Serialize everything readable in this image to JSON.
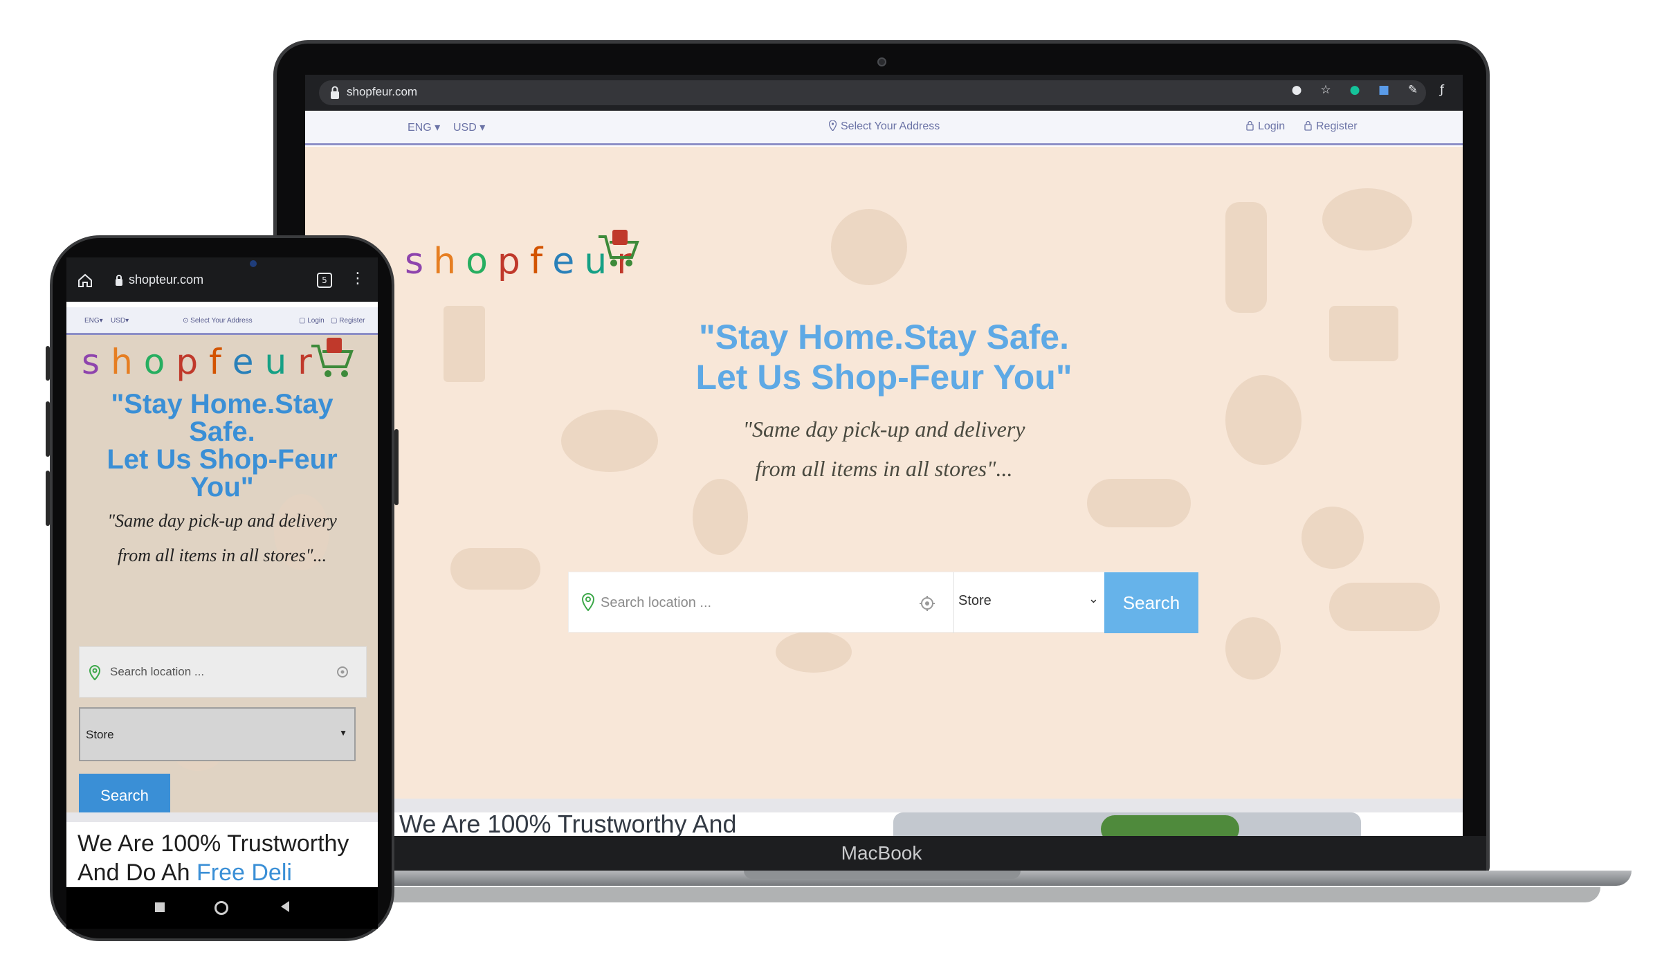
{
  "laptop": {
    "browser": {
      "url": "shopfeur.com"
    },
    "topbar": {
      "language": "ENG",
      "currency": "USD",
      "address_prompt": "Select Your Address",
      "login": "Login",
      "register": "Register"
    },
    "hero": {
      "logo_letters": [
        "s",
        "h",
        "o",
        "p",
        "f",
        "e",
        "u",
        "r"
      ],
      "title_line1": "\"Stay Home.Stay Safe.",
      "title_line2": "Let Us Shop-Feur You\"",
      "subtitle_line1": "\"Same day pick-up and delivery",
      "subtitle_line2": "from all items in all stores\"...",
      "search_placeholder": "Search location ...",
      "store_option": "Store",
      "search_button": "Search"
    },
    "section_heading": "We Are 100% Trustworthy And",
    "device_label": "MacBook"
  },
  "phone": {
    "browser": {
      "url": "shopteur.com",
      "tab_count": "5"
    },
    "topbar": {
      "language": "ENG",
      "currency": "USD",
      "address_prompt": "Select Your Address",
      "login": "Login",
      "register": "Register"
    },
    "hero": {
      "logo_letters": [
        "s",
        "h",
        "o",
        "p",
        "f",
        "e",
        "u",
        "r"
      ],
      "title_lines": [
        "\"Stay Home.Stay",
        "Safe.",
        "Let Us Shop-Feur",
        "You\""
      ],
      "subtitle_line1": "\"Same day pick-up and delivery",
      "subtitle_line2": "from all items in all stores\"...",
      "search_placeholder": "Search location ...",
      "store_option": "Store",
      "search_button": "Search"
    },
    "section_heading_line1": "We Are 100% Trustworthy",
    "section_heading_line2": "And Do Ah",
    "section_heading_accent": "Free Deli"
  },
  "colors": {
    "hero_bg_laptop": "#f8e7d8",
    "hero_bg_phone": "#e0d3c3",
    "accent_blue": "#5ea9e5",
    "button_blue": "#66b3ea",
    "logo_letter_colors": [
      "#8e44ad",
      "#e67e22",
      "#27ae60",
      "#c0392b",
      "#d35400",
      "#2980b9",
      "#16a085",
      "#c0392b"
    ]
  },
  "icons": [
    "lock-icon",
    "location-pin-icon",
    "target-icon",
    "cart-icon",
    "home-icon",
    "tabs-icon",
    "menu-icon",
    "star-icon"
  ]
}
